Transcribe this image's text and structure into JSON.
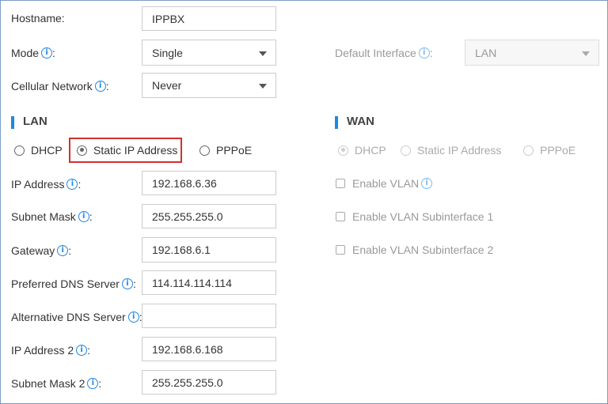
{
  "general": {
    "hostname_label": "Hostname:",
    "hostname_value": "IPPBX",
    "mode_label": "Mode",
    "mode_value": "Single",
    "cellular_label": "Cellular Network",
    "cellular_value": "Never",
    "default_interface_label": "Default Interface",
    "default_interface_value": "LAN",
    "colon": ":"
  },
  "lan": {
    "title": "LAN",
    "options": [
      "DHCP",
      "Static IP Address",
      "PPPoE"
    ],
    "selected": "Static IP Address",
    "fields": [
      {
        "label": "IP Address",
        "value": "192.168.6.36"
      },
      {
        "label": "Subnet Mask",
        "value": "255.255.255.0"
      },
      {
        "label": "Gateway",
        "value": "192.168.6.1"
      },
      {
        "label": "Preferred DNS Server",
        "value": "114.114.114.114"
      },
      {
        "label": "Alternative DNS Server",
        "value": ""
      },
      {
        "label": "IP Address 2",
        "value": "192.168.6.168"
      },
      {
        "label": "Subnet Mask 2",
        "value": "255.255.255.0"
      }
    ]
  },
  "wan": {
    "title": "WAN",
    "options": [
      "DHCP",
      "Static IP Address",
      "PPPoE"
    ],
    "selected": "DHCP",
    "checkboxes": [
      "Enable VLAN",
      "Enable VLAN Subinterface 1",
      "Enable VLAN Subinterface 2"
    ]
  },
  "colors": {
    "accent": "#1e88e5",
    "highlight": "#d32f2f",
    "frame": "#7a9cc7"
  },
  "icons": {
    "info": "i",
    "dropdown": "caret-down"
  }
}
